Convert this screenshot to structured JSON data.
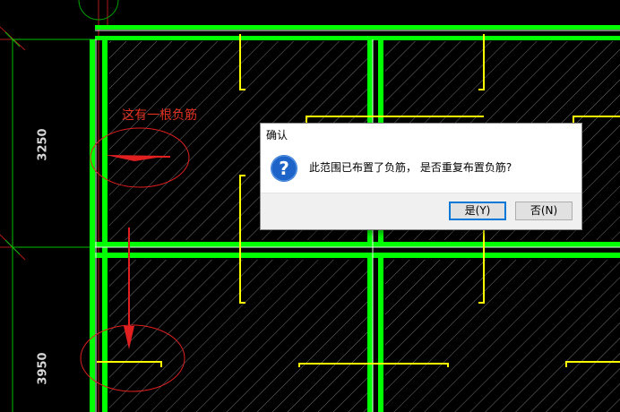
{
  "drawing": {
    "dimensions": [
      "3250",
      "3950"
    ],
    "annotation": "这有一根负筋",
    "colors": {
      "background": "#000000",
      "beam": "#00ff00",
      "rebar": "#ffff00",
      "hatch": "#9a9a9a",
      "annotation": "#e03020",
      "axis": "#c02020"
    }
  },
  "dialog": {
    "title": "确认",
    "icon": "question-icon",
    "message": "此范围已布置了负筋， 是否重复布置负筋?",
    "yes_label": "是(Y)",
    "no_label": "否(N)",
    "accent": "#0078d7"
  }
}
